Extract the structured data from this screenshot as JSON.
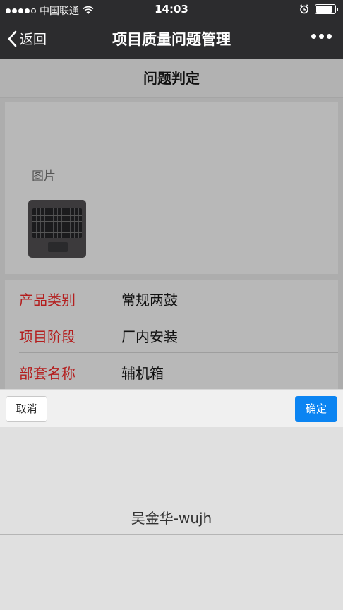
{
  "status_bar": {
    "carrier": "中国联通",
    "time": "14:03",
    "battery_level": 0.85,
    "signal_bars": 4
  },
  "nav": {
    "back_label": "返回",
    "title": "项目质量问题管理"
  },
  "page": {
    "header": "问题判定",
    "image_label": "图片"
  },
  "info_rows": [
    {
      "label": "产品类别",
      "value": "常规两鼓"
    },
    {
      "label": "项目阶段",
      "value": "厂内安装"
    },
    {
      "label": "部套名称",
      "value": "辅机箱"
    }
  ],
  "picker": {
    "cancel_label": "取消",
    "confirm_label": "确定",
    "selected_option": "吴金华-wujh"
  },
  "colors": {
    "nav_background": "#2c2c2e",
    "label_red": "#b41e1e",
    "confirm_blue": "#0b84f2"
  }
}
